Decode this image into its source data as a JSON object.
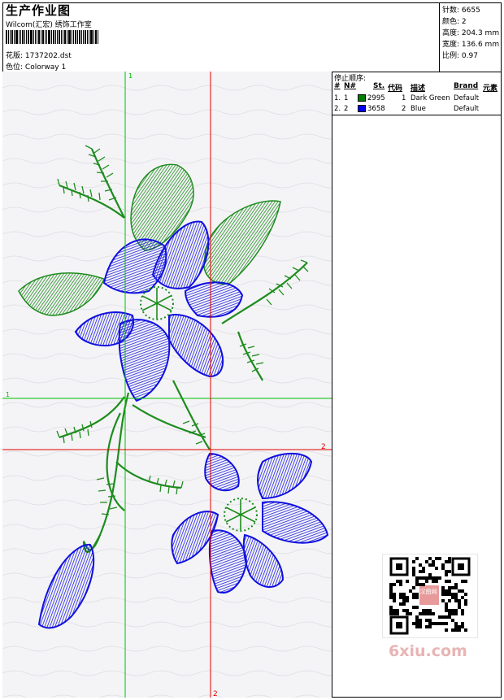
{
  "header": {
    "title": "生产作业图",
    "company": "Wilcom(汇宏) 绣饰工作室",
    "file_label": "花版:",
    "file_name": "1737202.dst",
    "colorway_label": "色位:",
    "colorway_name": "Colorway 1"
  },
  "stats": {
    "stitches_label": "针数:",
    "stitches": "6655",
    "colors_label": "颜色:",
    "colors": "2",
    "height_label": "高度:",
    "height": "204.3 mm",
    "width_label": "宽度:",
    "width": "136.6 mm",
    "scale_label": "比例:",
    "scale": "0.97"
  },
  "stop_sequence": {
    "title": "停止顺序:",
    "columns": [
      "#",
      "N#",
      "St.",
      "代码",
      "描述",
      "Brand",
      "元素"
    ],
    "rows": [
      {
        "num": "1.",
        "n": "1",
        "color": "#008000",
        "stitches": "2995",
        "code": "1",
        "description": "Dark Green",
        "brand": "Default"
      },
      {
        "num": "2.",
        "n": "2",
        "color": "#0000ff",
        "stitches": "3658",
        "code": "2",
        "description": "Blue",
        "brand": "Default"
      }
    ]
  },
  "guides": {
    "v_green_label": "1",
    "h_green_label": "1",
    "h_red_label": "2",
    "v_red_label": "2"
  },
  "colors": {
    "green": "#1e8c1e",
    "blue": "#1010e0",
    "guide_green": "#00c000",
    "guide_red": "#e00000"
  },
  "watermark": "6xiu.com",
  "qr_badge": "汉图网"
}
